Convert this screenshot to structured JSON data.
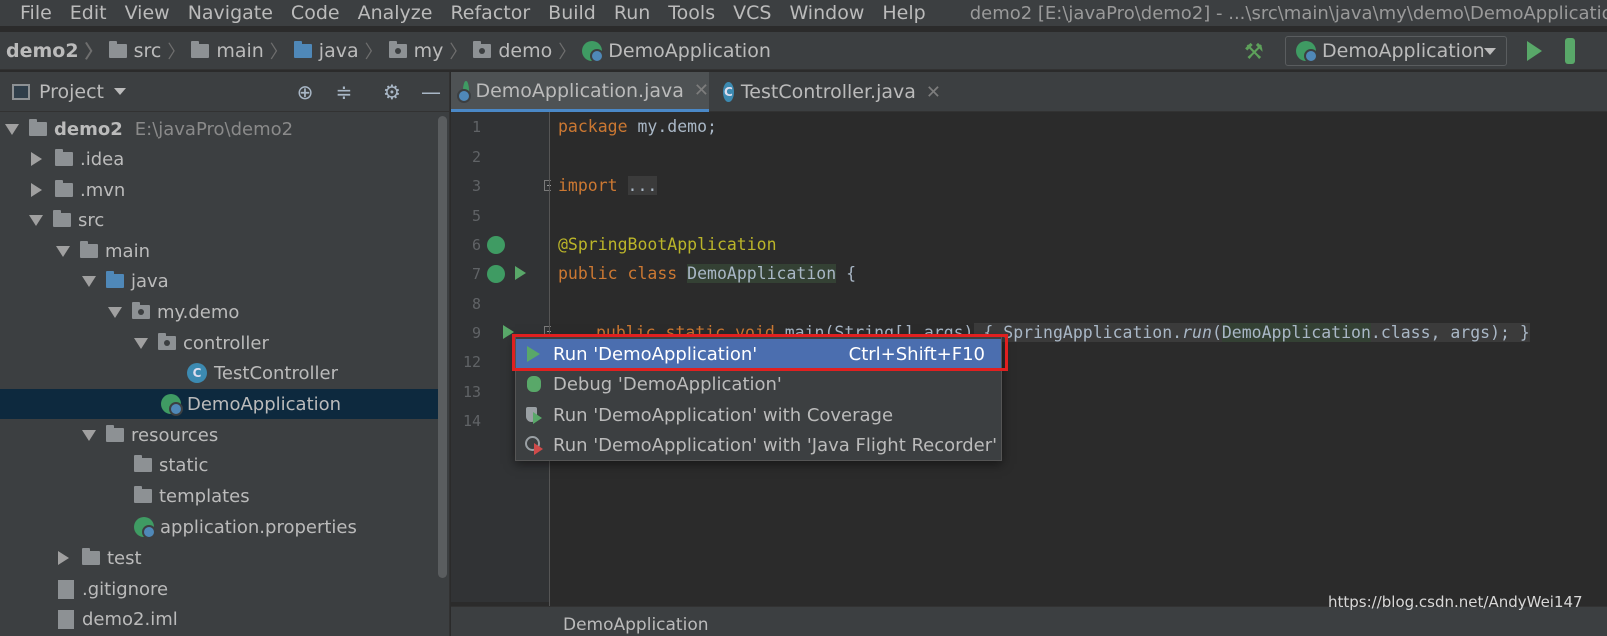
{
  "menubar": {
    "items": [
      "File",
      "Edit",
      "View",
      "Navigate",
      "Code",
      "Analyze",
      "Refactor",
      "Build",
      "Run",
      "Tools",
      "VCS",
      "Window",
      "Help"
    ],
    "title": "demo2 [E:\\javaPro\\demo2] - ...\\src\\main\\java\\my\\demo\\DemoApplication.java"
  },
  "breadcrumb": [
    "demo2",
    "src",
    "main",
    "java",
    "my",
    "demo",
    "DemoApplication"
  ],
  "run_config": {
    "label": "DemoApplication"
  },
  "project": {
    "title": "Project",
    "tree": [
      {
        "label": "demo2",
        "path": "E:\\javaPro\\demo2"
      },
      {
        "label": ".idea"
      },
      {
        "label": ".mvn"
      },
      {
        "label": "src"
      },
      {
        "label": "main"
      },
      {
        "label": "java"
      },
      {
        "label": "my.demo"
      },
      {
        "label": "controller"
      },
      {
        "label": "TestController"
      },
      {
        "label": "DemoApplication"
      },
      {
        "label": "resources"
      },
      {
        "label": "static"
      },
      {
        "label": "templates"
      },
      {
        "label": "application.properties"
      },
      {
        "label": "test"
      },
      {
        "label": ".gitignore"
      },
      {
        "label": "demo2.iml"
      }
    ]
  },
  "tabs": [
    {
      "label": "DemoApplication.java",
      "active": true
    },
    {
      "label": "TestController.java",
      "active": false
    }
  ],
  "editor": {
    "line_numbers": [
      "1",
      "2",
      "3",
      "5",
      "6",
      "7",
      "8",
      "9",
      "12",
      "13",
      "14"
    ],
    "code": {
      "l1_kw": "package",
      "l1_rest": " my.demo;",
      "l3_kw": "import",
      "l3_fold": "...",
      "l6": "@SpringBootApplication",
      "l7_kw": "public class",
      "l7_cls": "DemoApplication",
      "l7_end": " {",
      "l9_kw": "public static void",
      "l9_rest": " main(String[] args)",
      "l9_body_a": " { SpringApplication.",
      "l9_run": "run",
      "l9_body_b": "(",
      "l9_cls": "DemoApplication",
      "l9_dot": ".",
      "l9_class": "class",
      "l9_args": ", args); }"
    }
  },
  "popup": {
    "items": [
      {
        "label": "Run 'DemoApplication'",
        "shortcut": "Ctrl+Shift+F10"
      },
      {
        "label": "Debug 'DemoApplication'"
      },
      {
        "label": "Run 'DemoApplication' with Coverage"
      },
      {
        "label": "Run 'DemoApplication' with 'Java Flight Recorder'"
      }
    ]
  },
  "statusbar": {
    "crumb": "DemoApplication"
  },
  "watermark": "https://blog.csdn.net/AndyWei147",
  "colors": {
    "accent": "#4b6eaf",
    "highlight_border": "#e02020",
    "run_green": "#59a869"
  }
}
